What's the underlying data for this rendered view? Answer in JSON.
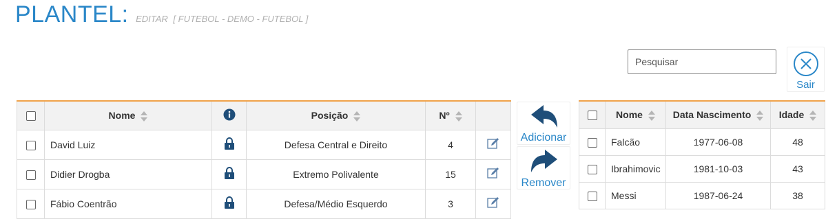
{
  "header": {
    "title": "PLANTEL:",
    "mode": "EDITAR",
    "context": "[ FUTEBOL - DEMO - FUTEBOL ]"
  },
  "search": {
    "placeholder": "Pesquisar",
    "value": ""
  },
  "exit_button": {
    "label": "Sair",
    "icon": "close-circle-icon"
  },
  "colors": {
    "accent": "#2a87c8",
    "table_top_border": "#f0a24a",
    "header_bg": "#f2f2f2"
  },
  "squad_table": {
    "columns": {
      "name": "Nome",
      "position": "Posição",
      "number": "Nº",
      "info_icon": "info-icon"
    },
    "rows": [
      {
        "name": "David Luiz",
        "position": "Defesa Central e Direito",
        "number": "4"
      },
      {
        "name": "Didier Drogba",
        "position": "Extremo Polivalente",
        "number": "15"
      },
      {
        "name": "Fábio Coentrão",
        "position": "Defesa/Médio Esquerdo",
        "number": "3"
      }
    ]
  },
  "actions": {
    "add_label": "Adicionar",
    "add_icon": "reply-arrow-icon",
    "remove_label": "Remover",
    "remove_icon": "forward-arrow-icon"
  },
  "available_table": {
    "columns": {
      "name": "Nome",
      "birth_date": "Data Nascimento",
      "age": "Idade"
    },
    "rows": [
      {
        "name": "Falcão",
        "birth_date": "1977-06-08",
        "age": "48"
      },
      {
        "name": "Ibrahimovic",
        "birth_date": "1981-10-03",
        "age": "43"
      },
      {
        "name": "Messi",
        "birth_date": "1987-06-24",
        "age": "38"
      }
    ]
  }
}
